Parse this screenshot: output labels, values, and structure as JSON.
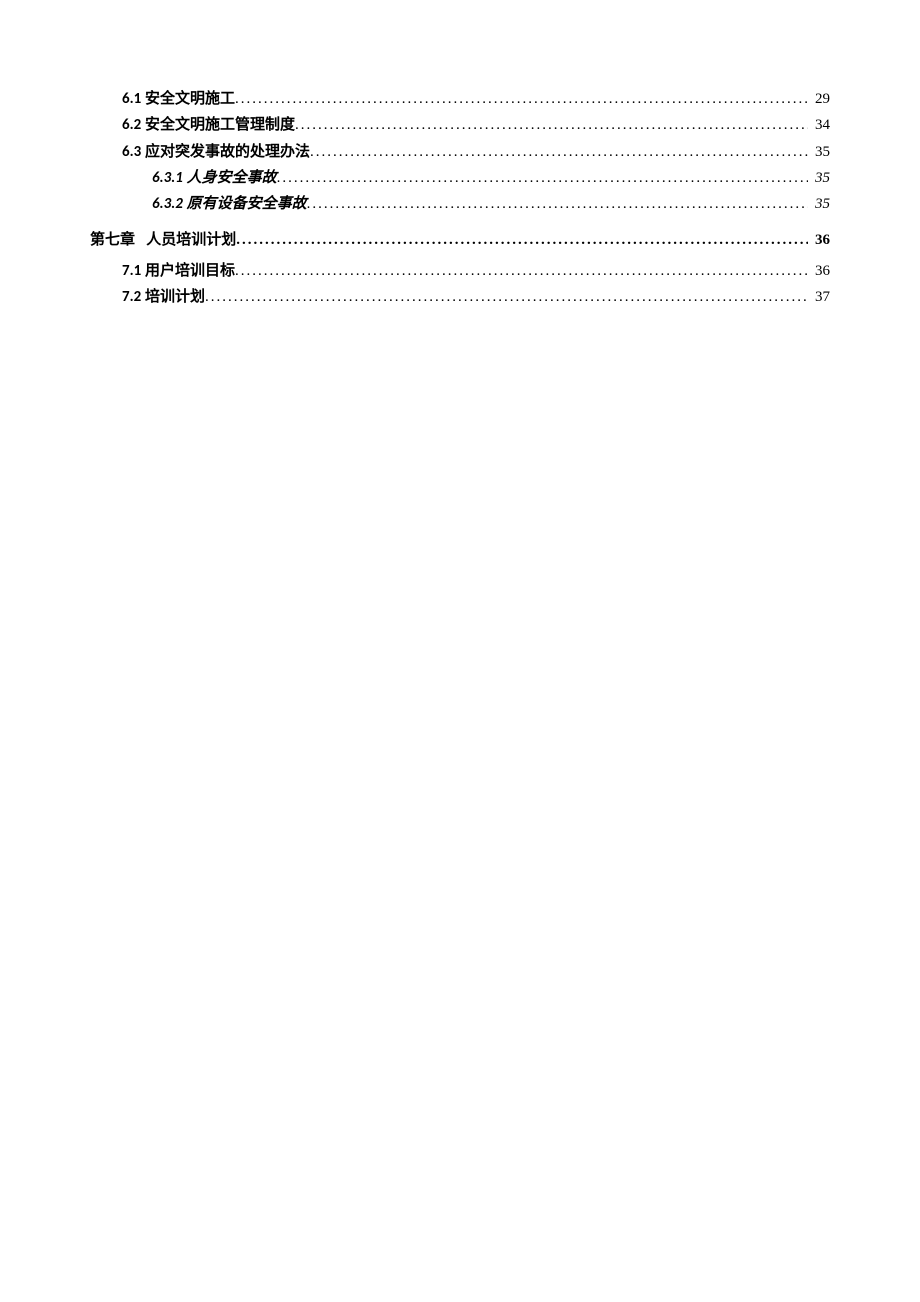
{
  "toc": {
    "entries": [
      {
        "level": 1,
        "number": "6.1",
        "title": "安全文明施工",
        "page": "29",
        "italic": false
      },
      {
        "level": 1,
        "number": "6.2",
        "title": "安全文明施工管理制度",
        "page": "34",
        "italic": false
      },
      {
        "level": 1,
        "number": "6.3",
        "title": "应对突发事故的处理办法",
        "page": "35",
        "italic": false
      },
      {
        "level": 2,
        "number": "6.3.1",
        "title": "人身安全事故",
        "page": "35",
        "italic": true
      },
      {
        "level": 2,
        "number": "6.3.2",
        "title": "原有设备安全事故",
        "page": "35",
        "italic": true
      },
      {
        "level": 0,
        "number": "第七章",
        "title": "人员培训计划",
        "page": "36",
        "italic": false
      },
      {
        "level": 1,
        "number": "7.1",
        "title": "用户培训目标",
        "page": "36",
        "italic": false
      },
      {
        "level": 1,
        "number": "7.2",
        "title": "培训计划",
        "page": "37",
        "italic": false
      }
    ]
  }
}
